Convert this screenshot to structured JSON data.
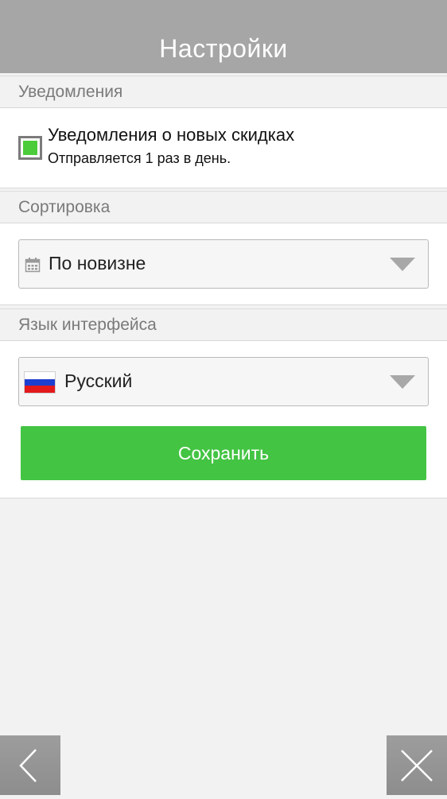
{
  "header": {
    "title": "Настройки"
  },
  "notifications": {
    "section_label": "Уведомления",
    "checkbox_title": "Уведомления о новых скидках",
    "checkbox_subtitle": "Отправляется 1 раз в день.",
    "checked": true,
    "check_color": "#4ccc3a"
  },
  "sorting": {
    "section_label": "Сортировка",
    "selected": "По новизне",
    "icon": "calendar-icon"
  },
  "language": {
    "section_label": "Язык интерфейса",
    "selected": "Русский",
    "icon": "russian-flag-icon"
  },
  "save_button": {
    "label": "Сохранить",
    "color": "#43c443"
  },
  "bottom_nav": {
    "back_icon": "chevron-left-icon",
    "close_icon": "close-icon"
  },
  "colors": {
    "header_bg": "#a6a6a6",
    "page_bg": "#f2f2f2"
  }
}
